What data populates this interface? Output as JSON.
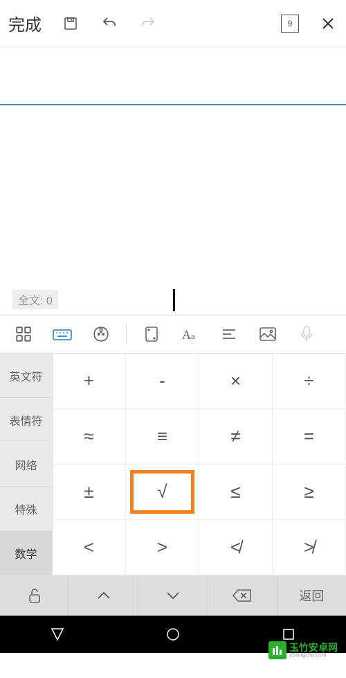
{
  "topbar": {
    "done_label": "完成",
    "page_number": "9"
  },
  "content": {
    "word_count_label": "全文: 0"
  },
  "categories": {
    "items": [
      {
        "label": "英文符"
      },
      {
        "label": "表情符"
      },
      {
        "label": "网络"
      },
      {
        "label": "特殊"
      },
      {
        "label": "数学"
      }
    ]
  },
  "symbols": {
    "rows": [
      [
        "+",
        "-",
        "×",
        "÷"
      ],
      [
        "≈",
        "≡",
        "≠",
        "="
      ],
      [
        "±",
        "√",
        "≤",
        "≥"
      ],
      [
        "<",
        ">",
        "≮",
        "≯"
      ]
    ],
    "highlighted": "√"
  },
  "bottom": {
    "back_label": "返回"
  },
  "watermark": {
    "main": "玉竹安卓网",
    "sub": "yzlangcha.com"
  }
}
